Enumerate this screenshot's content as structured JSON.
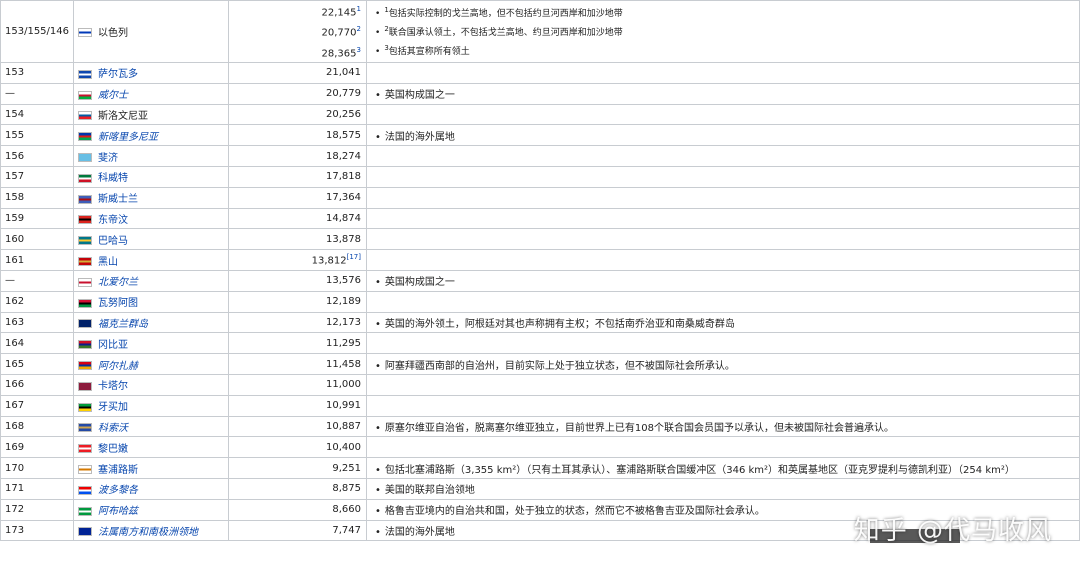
{
  "rows": [
    {
      "rank": "153/155/146",
      "name": "以色列",
      "flag": [
        "#ffffff",
        "#0038b8",
        "#ffffff"
      ],
      "link": false,
      "areas": [
        [
          "22,145",
          "1"
        ],
        [
          "20,770",
          "2"
        ],
        [
          "28,365",
          "3"
        ]
      ],
      "notes": [
        [
          "1",
          "包括实际控制的戈兰高地，但不包括约旦河西岸和加沙地带"
        ],
        [
          "2",
          "联合国承认领土，不包括戈兰高地、约旦河西岸和加沙地带"
        ],
        [
          "3",
          "包括其宣称所有领土"
        ]
      ]
    },
    {
      "rank": "153",
      "name": "萨尔瓦多",
      "flag": [
        "#0f47af",
        "#ffffff",
        "#0f47af"
      ],
      "link": true,
      "area": "21,041",
      "note": ""
    },
    {
      "rank": "—",
      "name": "威尔士",
      "flag": [
        "#ffffff",
        "#c8102e",
        "#00b140"
      ],
      "link": true,
      "italic": true,
      "area": "20,779",
      "note": "英国构成国之一"
    },
    {
      "rank": "154",
      "name": "斯洛文尼亚",
      "flag": [
        "#ffffff",
        "#005da4",
        "#ed1c24"
      ],
      "link": false,
      "area": "20,256",
      "note": ""
    },
    {
      "rank": "155",
      "name": "新喀里多尼亚",
      "flag": [
        "#0035ad",
        "#e41b13",
        "#00a651"
      ],
      "link": true,
      "italic": true,
      "area": "18,575",
      "note": "法国的海外属地"
    },
    {
      "rank": "156",
      "name": "斐济",
      "flag": [
        "#68bfe5",
        "#68bfe5",
        "#68bfe5"
      ],
      "link": true,
      "area": "18,274",
      "note": ""
    },
    {
      "rank": "157",
      "name": "科威特",
      "flag": [
        "#007a3d",
        "#ffffff",
        "#ce1126"
      ],
      "link": true,
      "area": "17,818",
      "note": ""
    },
    {
      "rank": "158",
      "name": "斯威士兰",
      "flag": [
        "#3e5eb9",
        "#b10c0c",
        "#3e5eb9"
      ],
      "link": true,
      "area": "17,364",
      "note": ""
    },
    {
      "rank": "159",
      "name": "东帝汶",
      "flag": [
        "#dc241f",
        "#000000",
        "#dc241f"
      ],
      "link": true,
      "area": "14,874",
      "note": ""
    },
    {
      "rank": "160",
      "name": "巴哈马",
      "flag": [
        "#00778b",
        "#ffc72c",
        "#00778b"
      ],
      "link": true,
      "area": "13,878",
      "note": ""
    },
    {
      "rank": "161",
      "name": "黑山",
      "flag": [
        "#c40308",
        "#d4af37",
        "#c40308"
      ],
      "link": true,
      "area": "13,812",
      "sup": "[17]",
      "note": ""
    },
    {
      "rank": "—",
      "name": "北爱尔兰",
      "flag": [
        "#ffffff",
        "#c8102e",
        "#ffffff"
      ],
      "link": true,
      "italic": true,
      "area": "13,576",
      "note": "英国构成国之一"
    },
    {
      "rank": "162",
      "name": "瓦努阿图",
      "flag": [
        "#d21034",
        "#000000",
        "#009543"
      ],
      "link": true,
      "area": "12,189",
      "note": ""
    },
    {
      "rank": "163",
      "name": "福克兰群岛",
      "flag": [
        "#012169",
        "#012169",
        "#012169"
      ],
      "link": true,
      "italic": true,
      "area": "12,173",
      "note": "英国的海外领土，阿根廷对其也声称拥有主权；不包括南乔治亚和南桑威奇群岛"
    },
    {
      "rank": "164",
      "name": "冈比亚",
      "flag": [
        "#ce1126",
        "#0c1c8c",
        "#3a7728"
      ],
      "link": true,
      "area": "11,295",
      "note": ""
    },
    {
      "rank": "165",
      "name": "阿尔扎赫",
      "flag": [
        "#d90012",
        "#0033a0",
        "#f2a800"
      ],
      "link": true,
      "italic": true,
      "area": "11,458",
      "note": "阿塞拜疆西南部的自治州，目前实际上处于独立状态，但不被国际社会所承认。"
    },
    {
      "rank": "166",
      "name": "卡塔尔",
      "flag": [
        "#8d1b3d",
        "#8d1b3d",
        "#8d1b3d"
      ],
      "link": true,
      "area": "11,000",
      "note": ""
    },
    {
      "rank": "167",
      "name": "牙买加",
      "flag": [
        "#009b3a",
        "#000000",
        "#fed100"
      ],
      "link": true,
      "area": "10,991",
      "note": ""
    },
    {
      "rank": "168",
      "name": "科索沃",
      "flag": [
        "#244aa5",
        "#d0a650",
        "#244aa5"
      ],
      "link": true,
      "italic": true,
      "area": "10,887",
      "note": "原塞尔维亚自治省，脱离塞尔维亚独立，目前世界上已有108个联合国会员国予以承认，但未被国际社会普遍承认。"
    },
    {
      "rank": "169",
      "name": "黎巴嫩",
      "flag": [
        "#ed1c24",
        "#ffffff",
        "#ed1c24"
      ],
      "link": true,
      "area": "10,400",
      "note": ""
    },
    {
      "rank": "170",
      "name": "塞浦路斯",
      "flag": [
        "#ffffff",
        "#d57800",
        "#ffffff"
      ],
      "link": true,
      "area": "9,251",
      "note": "包括北塞浦路斯（3,355 km²）（只有土耳其承认）、塞浦路斯联合国缓冲区（346 km²）和英属基地区（亚克罗提利与德凯利亚）（254 km²）"
    },
    {
      "rank": "171",
      "name": "波多黎各",
      "flag": [
        "#ed0000",
        "#ffffff",
        "#0050f0"
      ],
      "link": true,
      "italic": true,
      "area": "8,875",
      "note": "美国的联邦自治领地"
    },
    {
      "rank": "172",
      "name": "阿布哈兹",
      "flag": [
        "#00993e",
        "#ffffff",
        "#00993e"
      ],
      "link": true,
      "italic": true,
      "area": "8,660",
      "note": "格鲁吉亚境内的自治共和国，处于独立的状态，然而它不被格鲁吉亚及国际社会承认。"
    },
    {
      "rank": "173",
      "name": "法属南方和南极洲领地",
      "flag": [
        "#002395",
        "#002395",
        "#002395"
      ],
      "link": true,
      "italic": true,
      "area": "7,747",
      "note": "法国的海外属地"
    }
  ],
  "bullet": "•",
  "watermark": "知乎 @代马收风"
}
